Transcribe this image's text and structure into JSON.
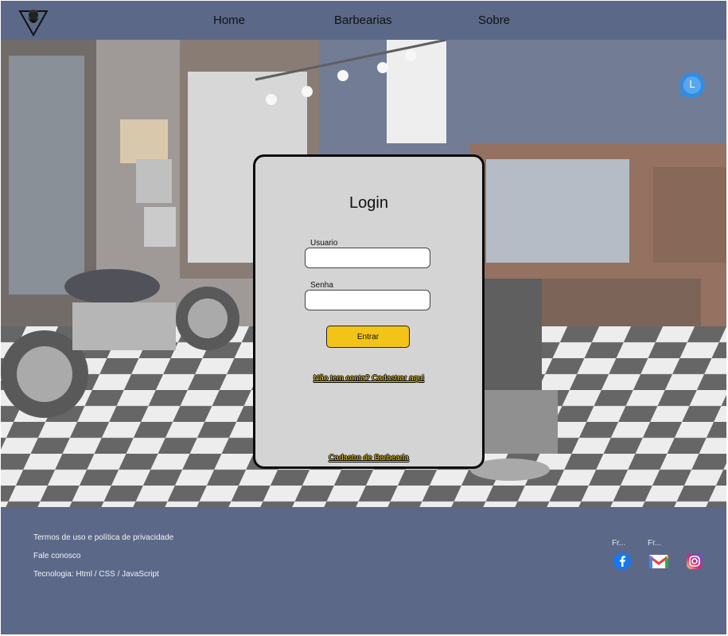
{
  "header": {
    "nav": [
      {
        "label": "Home"
      },
      {
        "label": "Barbearias"
      },
      {
        "label": "Sobre"
      }
    ]
  },
  "avatar": {
    "letter": "L"
  },
  "login": {
    "title": "Login",
    "username_label": "Usuario",
    "username_value": "",
    "password_label": "Senha",
    "password_value": "",
    "submit_label": "Entrar",
    "register_link": "Não tem conta? Cadastrar aqui",
    "barbershop_link": "Cadastro de Barbearia"
  },
  "footer": {
    "links": [
      {
        "label": "Termos de uso e política de privacidade"
      },
      {
        "label": "Fale conosco"
      },
      {
        "label": "Tecnologia: Html / CSS / JavaScript"
      }
    ],
    "social_labels": [
      "Fr...",
      "Fr..."
    ],
    "social_icons": [
      "facebook-icon",
      "gmail-icon",
      "instagram-icon"
    ]
  },
  "colors": {
    "header_bg": "#5b6888",
    "footer_bg": "#5b6888",
    "card_bg": "#d4d4d4",
    "button_bg": "#f2c418",
    "link_color": "#f5d33a",
    "avatar_bg": "#2f8de4"
  }
}
